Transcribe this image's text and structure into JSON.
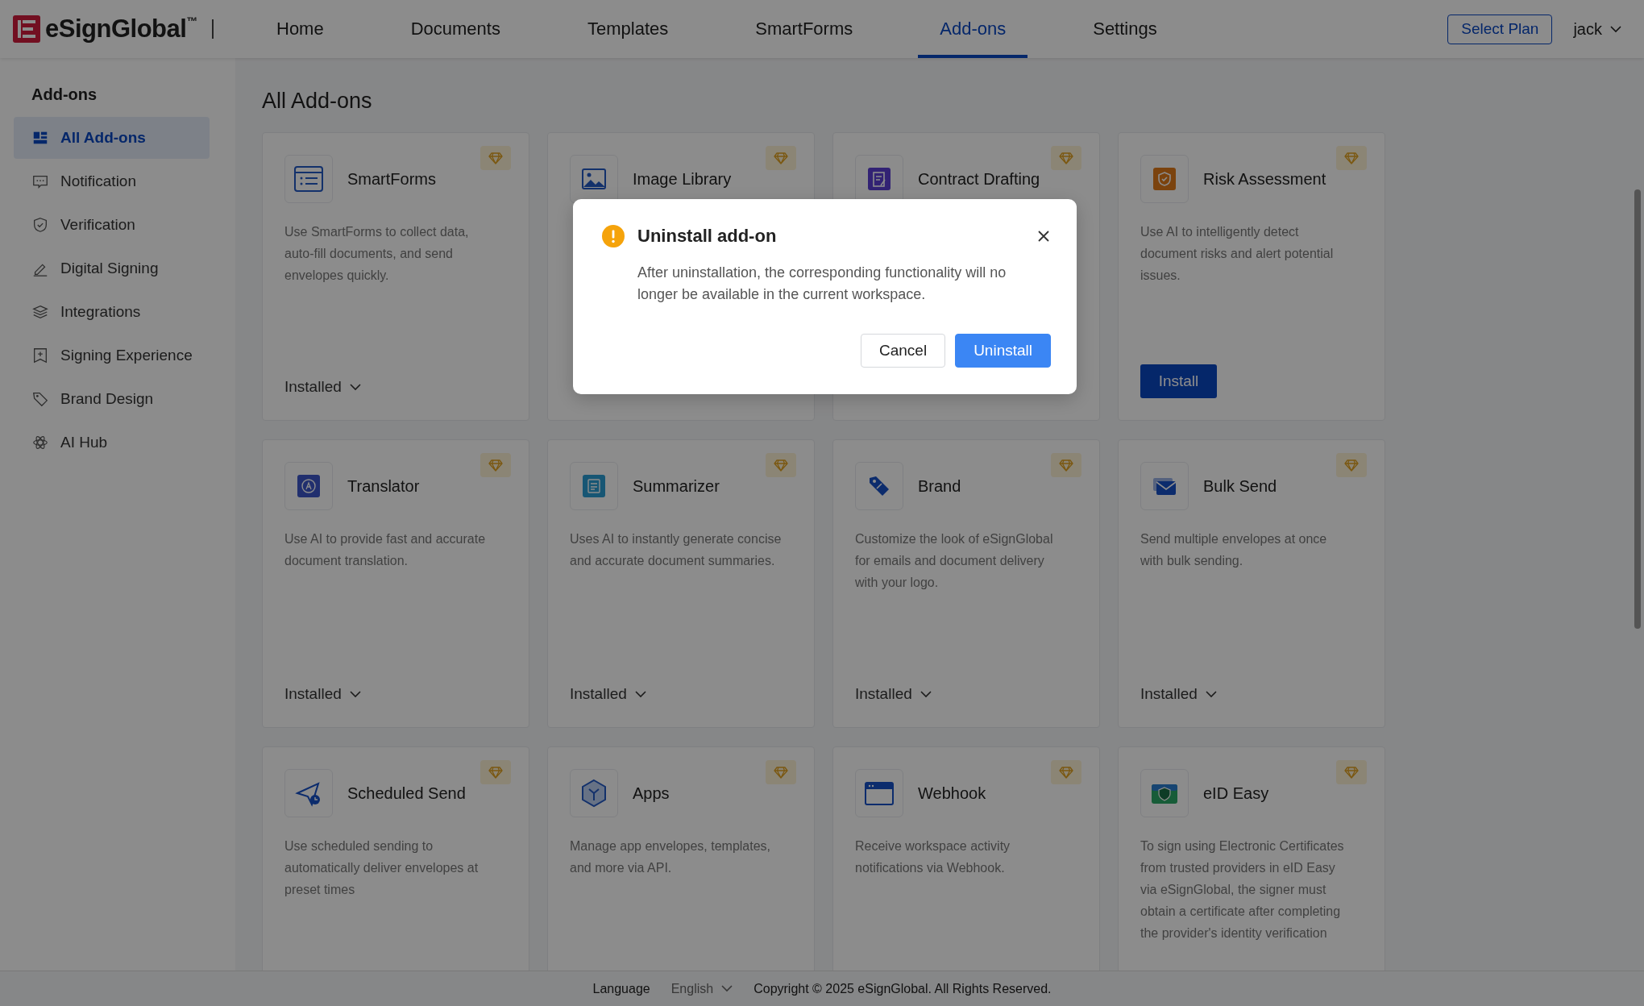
{
  "header": {
    "logo": "eSignGlobal",
    "trademark": "™",
    "nav": [
      {
        "label": "Home",
        "selected": false
      },
      {
        "label": "Documents",
        "selected": false
      },
      {
        "label": "Templates",
        "selected": false
      },
      {
        "label": "SmartForms",
        "selected": false
      },
      {
        "label": "Add-ons",
        "selected": true
      },
      {
        "label": "Settings",
        "selected": false
      }
    ],
    "select_plan": "Select Plan",
    "user": "jack"
  },
  "sidebar": {
    "title": "Add-ons",
    "items": [
      {
        "label": "All Add-ons",
        "selected": true
      },
      {
        "label": "Notification",
        "selected": false
      },
      {
        "label": "Verification",
        "selected": false
      },
      {
        "label": "Digital Signing",
        "selected": false
      },
      {
        "label": "Integrations",
        "selected": false
      },
      {
        "label": "Signing Experience",
        "selected": false
      },
      {
        "label": "Brand Design",
        "selected": false
      },
      {
        "label": "AI Hub",
        "selected": false
      }
    ]
  },
  "page_title": "All Add-ons",
  "cards": [
    {
      "title": "SmartForms",
      "description": "Use SmartForms to collect data, auto-fill documents, and send envelopes quickly.",
      "status": {
        "kind": "installed",
        "label": "Installed"
      }
    },
    {
      "title": "Image Library"
    },
    {
      "title": "Contract Drafting"
    },
    {
      "title": "Risk Assessment",
      "description": "Use AI to intelligently detect document risks and alert potential issues.",
      "status": {
        "kind": "install",
        "label": "Install"
      }
    },
    {
      "title": "Translator",
      "description": "Use AI to provide fast and accurate document translation.",
      "status": {
        "kind": "installed",
        "label": "Installed"
      }
    },
    {
      "title": "Summarizer",
      "description": "Uses AI to instantly generate concise and accurate document summaries.",
      "status": {
        "kind": "installed",
        "label": "Installed"
      }
    },
    {
      "title": "Brand",
      "description": "Customize the look of eSignGlobal for emails and document delivery with your logo.",
      "status": {
        "kind": "installed",
        "label": "Installed"
      }
    },
    {
      "title": "Bulk Send",
      "description": "Send multiple envelopes at once with bulk sending.",
      "status": {
        "kind": "installed",
        "label": "Installed"
      }
    },
    {
      "title": "Scheduled Send",
      "description": "Use scheduled sending to automatically deliver envelopes at preset times"
    },
    {
      "title": "Apps",
      "description": "Manage app envelopes, templates, and more via API."
    },
    {
      "title": "Webhook",
      "description": "Receive workspace activity notifications via Webhook."
    },
    {
      "title": "eID Easy",
      "description": "To sign using Electronic Certificates from trusted providers in eID Easy via eSignGlobal, the signer must obtain a certificate after completing the provider's identity verification"
    }
  ],
  "modal": {
    "title": "Uninstall add-on",
    "message": "After uninstallation, the corresponding functionality will no longer be available in the current workspace.",
    "buttons": [
      {
        "kind": "secondary",
        "label": "Cancel"
      },
      {
        "kind": "primary",
        "label": "Uninstall"
      }
    ]
  },
  "footer": {
    "language_label": "Language",
    "language": "English",
    "copyright": "Copyright © 2025 eSignGlobal. All Rights Reserved."
  }
}
